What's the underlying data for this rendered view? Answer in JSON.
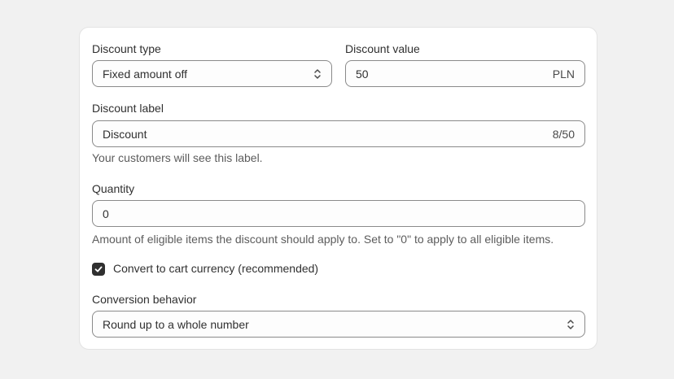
{
  "discount_type": {
    "label": "Discount type",
    "value": "Fixed amount off",
    "icon": "chevron-up-down-icon"
  },
  "discount_value": {
    "label": "Discount value",
    "value": "50",
    "suffix": "PLN"
  },
  "discount_label": {
    "label": "Discount label",
    "value": "Discount",
    "counter": "8/50",
    "help": "Your customers will see this label."
  },
  "quantity": {
    "label": "Quantity",
    "value": "0",
    "help": "Amount of eligible items the discount should apply to. Set to \"0\" to apply to all eligible items."
  },
  "convert_currency": {
    "label": "Convert to cart currency (recommended)",
    "checked": true
  },
  "conversion_behavior": {
    "label": "Conversion behavior",
    "value": "Round up to a whole number",
    "icon": "chevron-up-down-icon"
  },
  "colors": {
    "page_bg": "#f1f1f1",
    "card_bg": "#ffffff",
    "field_border": "#8a8a8a",
    "checkbox_fill": "#303030",
    "help_text": "#5c5c5c"
  }
}
